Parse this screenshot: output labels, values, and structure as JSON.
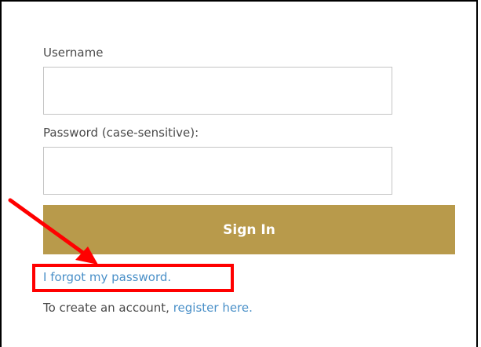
{
  "form": {
    "username_label": "Username",
    "username_value": "",
    "password_label": "Password (case-sensitive):",
    "password_value": "",
    "signin_label": "Sign In",
    "forgot_label": "I forgot my password.",
    "create_prefix": "To create an account, ",
    "register_label": "register here."
  },
  "colors": {
    "signin_bg": "#b89a4b",
    "link": "#4a90c8",
    "annotation": "#ff0000"
  },
  "annotation": {
    "arrow_icon": "arrow-icon",
    "highlight": "highlight-box"
  }
}
